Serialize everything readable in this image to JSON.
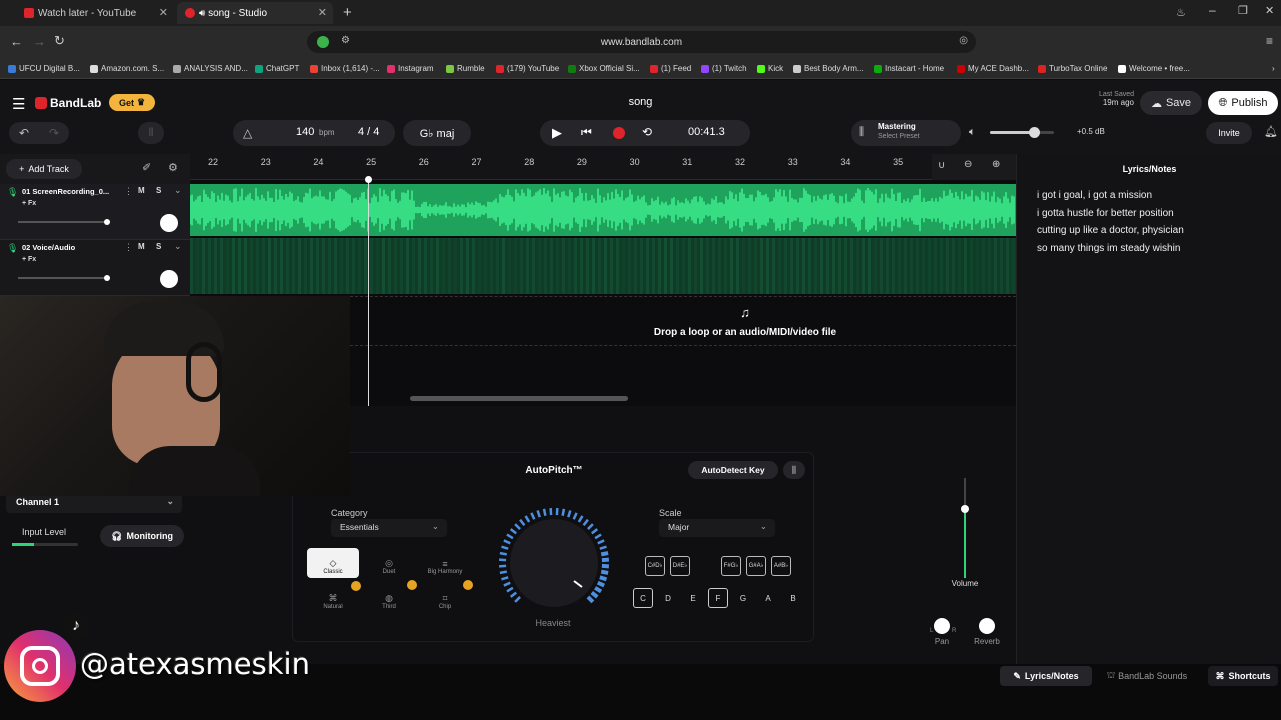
{
  "browser": {
    "tabs": [
      {
        "title": "Watch later - YouTube",
        "active": false
      },
      {
        "title": "song - Studio",
        "active": true
      }
    ],
    "url": "www.bandlab.com",
    "bookmarks": [
      "UFCU Digital B...",
      "Amazon.com. S...",
      "ANALYSIS AND...",
      "ChatGPT",
      "Inbox (1,614) -...",
      "Instagram",
      "Rumble",
      "(179) YouTube",
      "Xbox Official Si...",
      "(1) Feed",
      "(1) Twitch",
      "Kick",
      "Best Body Arm...",
      "Instacart - Home",
      "My ACE Dashb...",
      "TurboTax Online",
      "Welcome • free..."
    ]
  },
  "header": {
    "logo": "BandLab",
    "get_label": "Get",
    "song_title": "song",
    "last_saved_label": "Last Saved",
    "last_saved_time": "19m ago",
    "save_label": "Save",
    "publish_label": "Publish",
    "bpm_value": "140",
    "bpm_unit": "bpm",
    "time_signature": "4 / 4",
    "key": "G♭ maj",
    "time": "00:41.3",
    "mastering_label": "Mastering",
    "mastering_preset": "Select Preset",
    "volume_db": "+0.5 dB",
    "invite_label": "Invite",
    "master_volume": 0.68
  },
  "tracks": {
    "add_track_label": "Add Track",
    "items": [
      {
        "name": "01 ScreenRecording_0...",
        "fx": "+ Fx",
        "mute": "M",
        "solo": "S"
      },
      {
        "name": "02 Voice/Audio",
        "fx": "+ Fx",
        "mute": "M",
        "solo": "S"
      }
    ],
    "drop_text": "Drop a loop or an audio/MIDI/video file"
  },
  "ruler": {
    "bars": [
      "22",
      "23",
      "24",
      "25",
      "26",
      "27",
      "28",
      "29",
      "30",
      "31",
      "32",
      "33",
      "34",
      "35"
    ]
  },
  "lyrics": {
    "title": "Lyrics/Notes",
    "lines": [
      "i got i goal, i got a mission",
      "i gotta hustle for better position",
      "cutting up like a doctor, physician",
      "so many things im steady wishin"
    ]
  },
  "input": {
    "channel": "Channel 1",
    "input_level_label": "Input Level",
    "monitoring_label": "Monitoring"
  },
  "autopitch": {
    "title": "AutoPitch™",
    "autodetect_label": "AutoDetect Key",
    "category_label": "Category",
    "category_value": "Essentials",
    "categories": [
      "Classic",
      "Duet",
      "Big Harmony",
      "Natural",
      "Third",
      "Chip"
    ],
    "amount_label": "Heaviest",
    "scale_label": "Scale",
    "scale_value": "Major",
    "sharps": [
      {
        "top": "C#",
        "bottom": "D♭"
      },
      {
        "top": "D#",
        "bottom": "E♭"
      },
      {
        "top": "F#",
        "bottom": "G♭"
      },
      {
        "top": "G#",
        "bottom": "A♭"
      },
      {
        "top": "A#",
        "bottom": "B♭"
      }
    ],
    "naturals": [
      "C",
      "D",
      "E",
      "F",
      "G",
      "A",
      "B"
    ]
  },
  "mixer": {
    "volume_label": "Volume",
    "pan_label": "Pan",
    "reverb_label": "Reverb",
    "pan_marks": [
      "L",
      "R"
    ]
  },
  "bottom": {
    "lyrics_tab": "Lyrics/Notes",
    "sounds_tab": "BandLab Sounds",
    "shortcuts": "Shortcuts"
  },
  "overlay": {
    "handle": "@atexasmeskin"
  },
  "colors": {
    "accent_green": "#2ed47a",
    "record_red": "#e0242b",
    "get_yellow": "#f2b43c",
    "pitch_blue": "#4d8fe0"
  }
}
